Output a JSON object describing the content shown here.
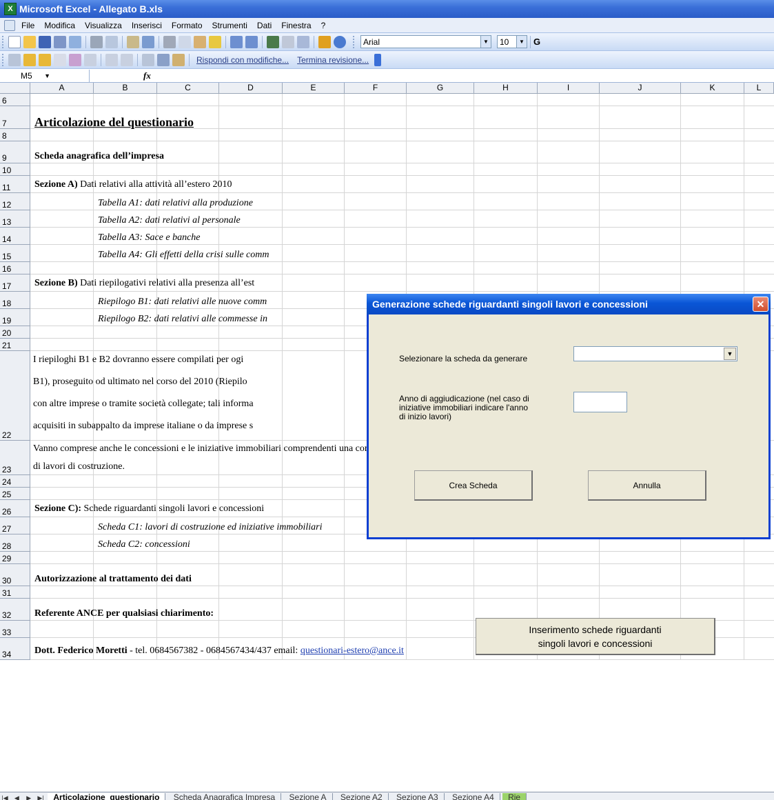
{
  "window": {
    "title": "Microsoft Excel - Allegato B.xls",
    "app_icon": "excel-icon"
  },
  "menu": [
    "File",
    "Modifica",
    "Visualizza",
    "Inserisci",
    "Formato",
    "Strumenti",
    "Dati",
    "Finestra",
    "?"
  ],
  "toolbar": {
    "font_name": "Arial",
    "font_size": "10",
    "bold_partial": "G",
    "review_reply": "Rispondi con modifiche...",
    "review_end": "Termina revisione..."
  },
  "formula_bar": {
    "name_box": "M5",
    "fx": "fx"
  },
  "columns": [
    "A",
    "B",
    "C",
    "D",
    "E",
    "F",
    "G",
    "H",
    "I",
    "J",
    "K",
    "L"
  ],
  "rows": [
    "6",
    "7",
    "8",
    "9",
    "10",
    "11",
    "12",
    "13",
    "14",
    "15",
    "16",
    "17",
    "18",
    "19",
    "20",
    "21",
    "22",
    "23",
    "24",
    "25",
    "26",
    "27",
    "28",
    "29",
    "30",
    "31",
    "32",
    "33",
    "34"
  ],
  "content": {
    "heading": "Articolazione del questionario",
    "scheda": "Scheda anagrafica dell’impresa",
    "sezA_bold": "Sezione A)",
    "sezA_text": " Dati relativi alla attività all’estero 2010",
    "a1": "Tabella A1: dati relativi alla produzione",
    "a2": "Tabella A2: dati relativi al personale",
    "a3": "Tabella A3: Sace e banche",
    "a4": "Tabella A4: Gli effetti della crisi sulle comm",
    "sezB_bold": "Sezione B)",
    "sezB_text": "  Dati riepilogativi relativi alla presenza all’est",
    "b1": "Riepilogo B1: dati relativi alle nuove comm",
    "b2": "Riepilogo B2: dati relativi alle commesse in",
    "p22_1": "I riepiloghi B1 e B2 dovranno essere compilati per ogi",
    "p22_2": "B1), proseguito od ultimato nel corso del 2010 (Riepilo",
    "p22_3": "con altre imprese o tramite società collegate; tali informa",
    "p22_4": "acquisiti in subappalto da imprese italiane o da imprese s",
    "p23_1": "Vanno comprese anche le concessioni e le iniziative immobiliari comprendenti una componente",
    "p23_2": "di lavori di costruzione.",
    "sezC_bold": "Sezione C):",
    "sezC_text": " Schede riguardanti singoli lavori e concessioni",
    "c1": "Scheda C1: lavori di costruzione ed iniziative immobiliari",
    "c2": "Scheda C2: concessioni",
    "auth": "Autorizzazione al trattamento dei dati",
    "ref": "Referente ANCE per qualsiasi chiarimento:",
    "contact_name": "Dott. Federico Moretti",
    "contact_tel": " - tel. 0684567382 - 0684567434/437  email: ",
    "contact_email": "questionari-estero@ance.it"
  },
  "insert_button": {
    "line1": "Inserimento schede riguardanti",
    "line2": "singoli lavori e concessioni"
  },
  "dialog": {
    "title": "Generazione schede riguardanti singoli lavori e concessioni",
    "select_label": "Selezionare la scheda da generare",
    "anno_label_1": "Anno di aggiudicazione (nel caso di",
    "anno_label_2": "iniziative immobiliari indicare l'anno",
    "anno_label_3": "di inizio lavori)",
    "create_button": "Crea Scheda",
    "cancel_button": "Annulla"
  },
  "sheet_tabs": [
    "Articolazione_questionario",
    "Scheda Anagrafica Impresa",
    "Sezione A",
    "Sezione A2",
    "Sezione A3",
    "Sezione A4",
    "Rie"
  ]
}
